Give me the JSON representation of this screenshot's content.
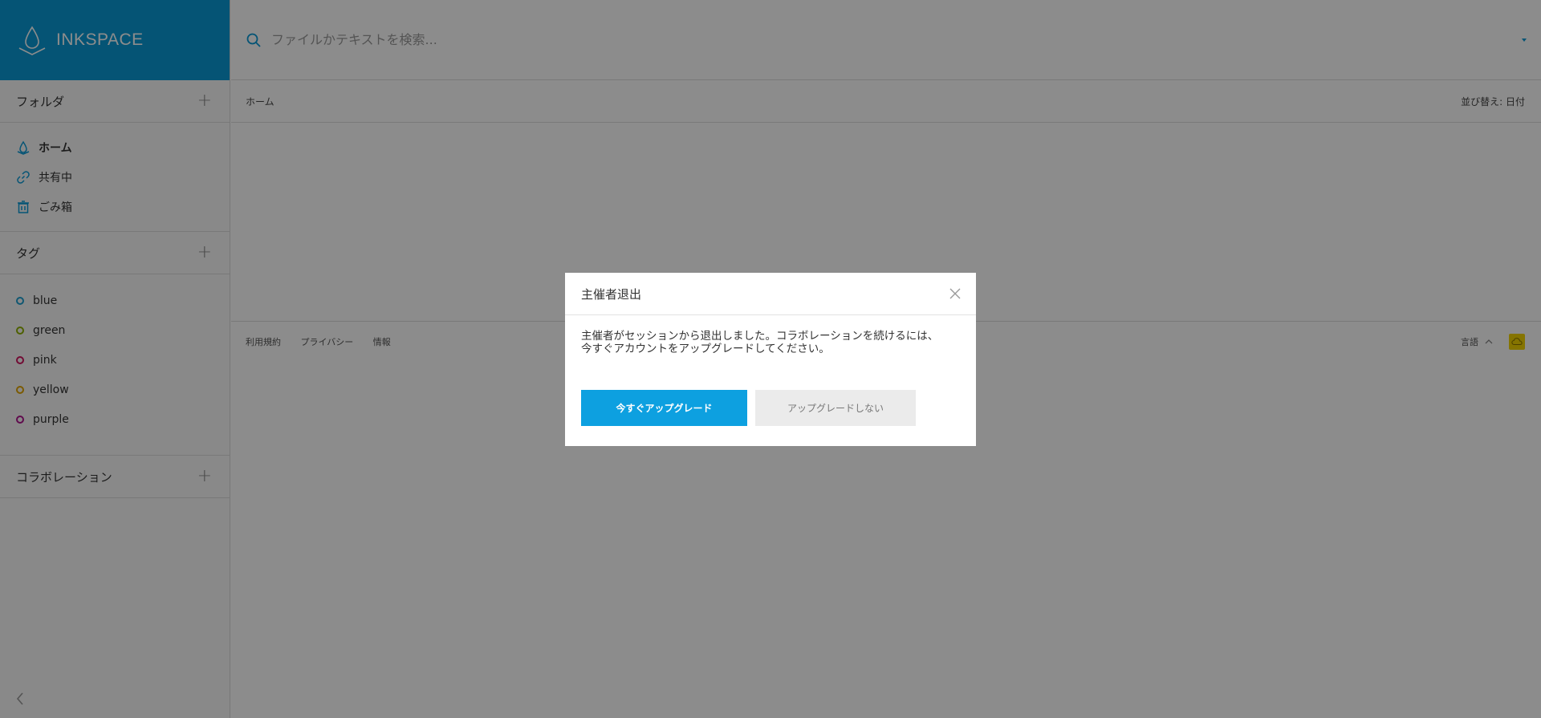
{
  "brand": {
    "name": "INKSPACE",
    "logo_icon": "ink-drop-icon",
    "color": "#0a9ad6"
  },
  "search": {
    "placeholder": "ファイルかテキストを検索..."
  },
  "sidebar": {
    "folders_header": "フォルダ",
    "nav_items": [
      {
        "label": "ホーム",
        "icon": "home-drop-icon"
      },
      {
        "label": "共有中",
        "icon": "link-icon"
      },
      {
        "label": "ごみ箱",
        "icon": "trash-icon"
      }
    ],
    "tags_header": "タグ",
    "tags": [
      {
        "label": "blue",
        "color": "#1e9fd0"
      },
      {
        "label": "green",
        "color": "#8fb000"
      },
      {
        "label": "pink",
        "color": "#d0155f"
      },
      {
        "label": "yellow",
        "color": "#e0a400"
      },
      {
        "label": "purple",
        "color": "#b0148c"
      }
    ],
    "collab_header": "コラボレーション"
  },
  "breadcrumb": {
    "current": "ホーム"
  },
  "sort": {
    "label": "並び替え: 日付"
  },
  "footer": {
    "links": [
      "利用規約",
      "プライバシー",
      "情報"
    ],
    "language": "言語",
    "cloud_color": "#f2d300"
  },
  "modal": {
    "title": "主催者退出",
    "message_line1": "主催者がセッションから退出しました。コラボレーションを続けるには、",
    "message_line2": "今すぐアカウントをアップグレードしてください。",
    "primary_button": "今すぐアップグレード",
    "secondary_button": "アップグレードしない",
    "primary_color": "#0da0e0"
  }
}
